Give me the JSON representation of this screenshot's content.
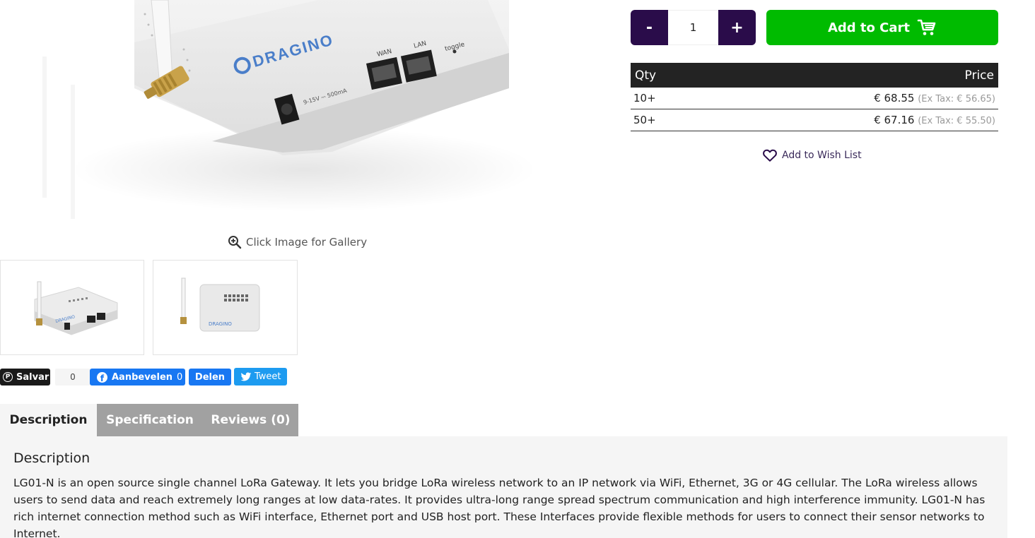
{
  "gallery": {
    "hint": "Click Image for Gallery",
    "brand_text": "DRAGINO",
    "ports": {
      "wan": "WAN",
      "lan": "LAN",
      "toggle": "toggle",
      "power": "9-15V ⎓ 500mA"
    }
  },
  "social": {
    "pinterest_label": "Salvar",
    "pinterest_count": "0",
    "facebook_like_label": "Aanbevelen",
    "facebook_like_count": "0",
    "facebook_share_label": "Delen",
    "tweet_label": "Tweet"
  },
  "tabs": [
    {
      "label": "Description",
      "active": true
    },
    {
      "label": "Specification",
      "active": false
    },
    {
      "label": "Reviews (0)",
      "active": false
    }
  ],
  "description": {
    "title": "Description",
    "body": "LG01-N is an open source single channel LoRa Gateway. It lets you bridge LoRa wireless network to an IP network via WiFi, Ethernet, 3G or 4G cellular. The LoRa wireless allows users to send data and reach extremely long ranges at low data-rates. It provides ultra-long range spread spectrum communication and high interference immunity. LG01-N has rich internet connection method such as WiFi interface, Ethernet port and USB host port. These Interfaces provide flexible methods for users to connect their sensor networks to Internet."
  },
  "purchase": {
    "minus_label": "-",
    "plus_label": "+",
    "quantity": "1",
    "add_to_cart_label": "Add to Cart",
    "wishlist_label": "Add to Wish List"
  },
  "price_table": {
    "headers": {
      "qty": "Qty",
      "price": "Price"
    },
    "rows": [
      {
        "qty": "10+",
        "price": "€ 68.55",
        "ex_tax": "(Ex Tax: € 56.65)"
      },
      {
        "qty": "50+",
        "price": "€ 67.16",
        "ex_tax": "(Ex Tax: € 55.50)"
      }
    ]
  },
  "colors": {
    "qty_buttons": "#2a0c4a",
    "cart_button": "#00bb00",
    "table_header": "#232323",
    "facebook": "#1877f2",
    "twitter": "#1d9bf0",
    "tab_inactive": "#a1a1a1"
  },
  "icons": {
    "gallery": "zoom-in-icon",
    "cart": "shopping-cart-icon",
    "wishlist": "heart-icon",
    "pinterest": "pinterest-icon",
    "facebook": "facebook-icon",
    "twitter": "twitter-bird-icon"
  }
}
